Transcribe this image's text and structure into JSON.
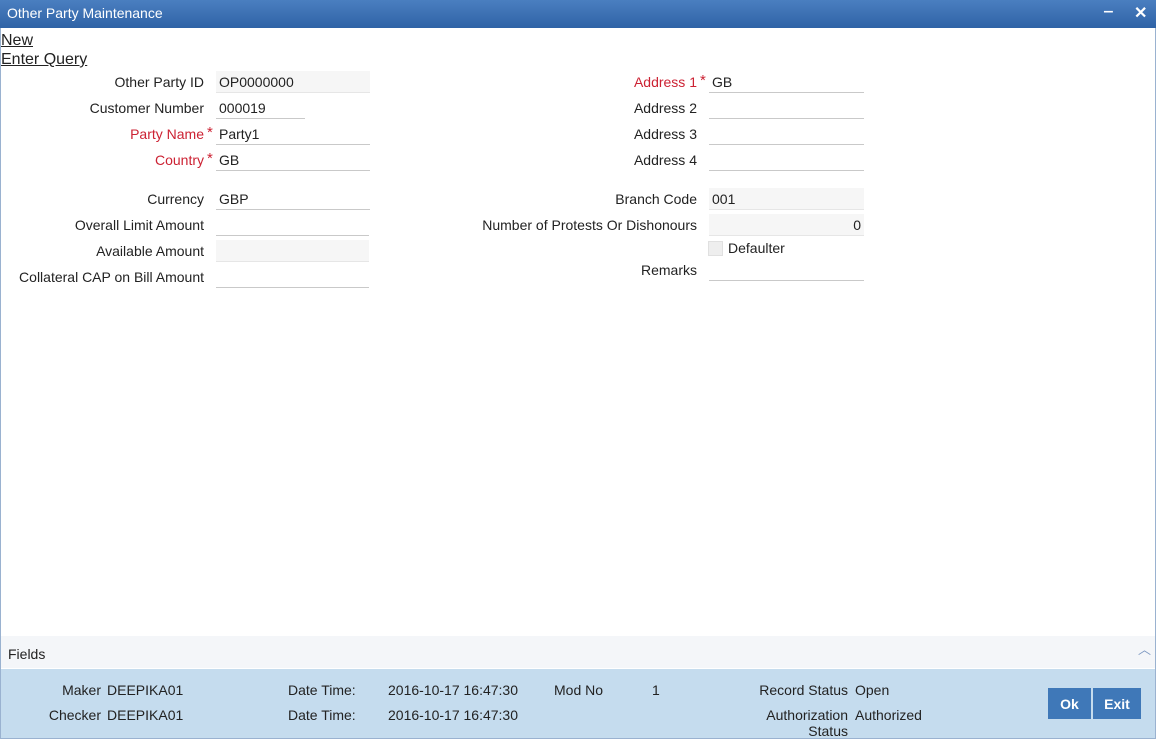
{
  "window": {
    "title": "Other Party Maintenance",
    "minimize_glyph": "‒",
    "close_glyph": "✕"
  },
  "menu": {
    "new": "New",
    "enter_query": "Enter Query"
  },
  "form": {
    "other_party_id": {
      "label": "Other Party ID",
      "value": "OP0000000"
    },
    "customer_number": {
      "label": "Customer Number",
      "value": "000019"
    },
    "party_name": {
      "label": "Party Name",
      "value": "Party1"
    },
    "country": {
      "label": "Country",
      "value": "GB"
    },
    "currency": {
      "label": "Currency",
      "value": "GBP"
    },
    "overall_limit": {
      "label": "Overall Limit Amount",
      "value": ""
    },
    "available_amount": {
      "label": "Available Amount",
      "value": ""
    },
    "collateral_cap": {
      "label": "Collateral CAP on Bill Amount",
      "value": ""
    },
    "address1": {
      "label": "Address 1",
      "value": "GB"
    },
    "address2": {
      "label": "Address 2",
      "value": ""
    },
    "address3": {
      "label": "Address 3",
      "value": ""
    },
    "address4": {
      "label": "Address 4",
      "value": ""
    },
    "branch_code": {
      "label": "Branch Code",
      "value": "001"
    },
    "protests": {
      "label": "Number of Protests Or Dishonours",
      "value": "0"
    },
    "defaulter": {
      "label": "Defaulter",
      "checked": false
    },
    "remarks": {
      "label": "Remarks",
      "value": ""
    },
    "required_marker": "*"
  },
  "fields_section": {
    "label": "Fields",
    "toggle_icon": "chevron-up-icon"
  },
  "footer": {
    "maker_label": "Maker",
    "maker": "DEEPIKA01",
    "checker_label": "Checker",
    "checker": "DEEPIKA01",
    "datetime_label": "Date Time:",
    "maker_datetime": "2016-10-17 16:47:30",
    "checker_datetime": "2016-10-17 16:47:30",
    "mod_no_label": "Mod No",
    "mod_no": "1",
    "record_status_label": "Record Status",
    "record_status": "Open",
    "auth_status_label_1": "Authorization",
    "auth_status_label_2": "Status",
    "auth_status": "Authorized",
    "ok": "Ok",
    "exit": "Exit"
  },
  "colors": {
    "titlebar": "#3f72b0",
    "required": "#cc2233",
    "footer": "#c5dcee",
    "button": "#3f78b8"
  }
}
